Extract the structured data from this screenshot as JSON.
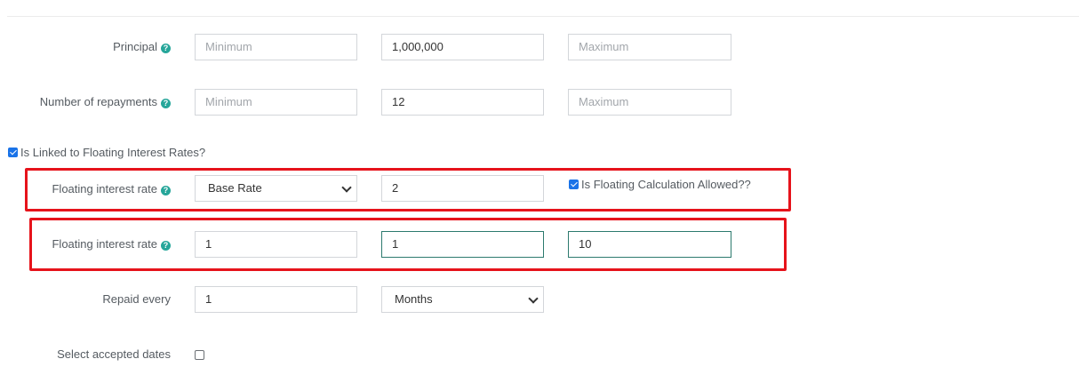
{
  "colors": {
    "accent": "#26a69a",
    "highlight_border": "#e6131b",
    "checkbox": "#1a73e8"
  },
  "principal": {
    "label": "Principal",
    "min_placeholder": "Minimum",
    "default": "1,000,000",
    "max_placeholder": "Maximum"
  },
  "repayments": {
    "label": "Number of repayments",
    "min_placeholder": "Minimum",
    "default": "12",
    "max_placeholder": "Maximum"
  },
  "floating_link": {
    "label": "Is Linked to Floating Interest Rates?",
    "checked": true
  },
  "floating_rate_1": {
    "label": "Floating interest rate",
    "select_value": "Base Rate",
    "differential": "2",
    "calc_allowed_label": "Is Floating Calculation Allowed??",
    "calc_allowed_checked": true
  },
  "floating_rate_2": {
    "label": "Floating interest rate",
    "min": "1",
    "default": "1",
    "max": "10"
  },
  "repaid_every": {
    "label": "Repaid every",
    "value": "1",
    "unit": "Months"
  },
  "accepted_dates": {
    "label": "Select accepted dates",
    "checked": false
  },
  "icons": {
    "help": "question-circle-icon",
    "dropdown": "chevron-down-icon",
    "checkbox": "checkbox-icon"
  }
}
